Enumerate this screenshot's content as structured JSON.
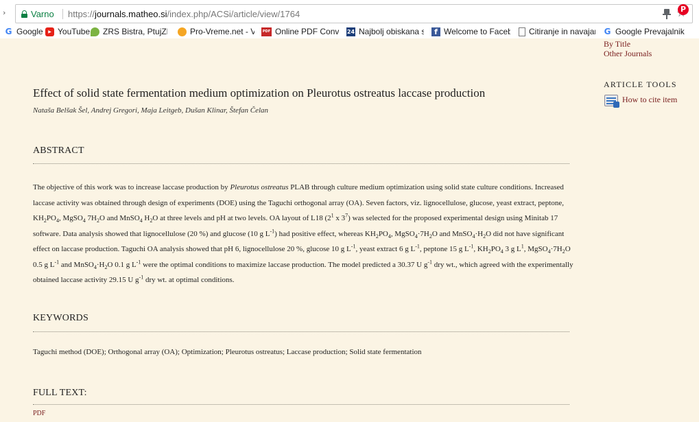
{
  "browser": {
    "secure_label": "Varno",
    "url_scheme": "https://",
    "url_host": "journals.matheo.si",
    "url_path": "/index.php/ACSi/article/view/1764"
  },
  "bookmarks": [
    {
      "label": "Google",
      "icon": "google-icon"
    },
    {
      "label": "YouTube",
      "icon": "youtube-icon"
    },
    {
      "label": "ZRS Bistra, PtujZRS Bi",
      "icon": "zrs-icon"
    },
    {
      "label": "Pro-Vreme.net - Vrem",
      "icon": "weather-icon"
    },
    {
      "label": "Online PDF Converter",
      "icon": "pdf-icon"
    },
    {
      "label": "Najbolj obiskana sple",
      "icon": "24ur-icon"
    },
    {
      "label": "Welcome to Faceboo",
      "icon": "facebook-icon"
    },
    {
      "label": "Citiranje in navajanje",
      "icon": "document-icon"
    },
    {
      "label": "Google Prevajalnik",
      "icon": "google-translate-icon"
    }
  ],
  "sidebar": {
    "by_title": "By Title",
    "other_journals": "Other Journals",
    "article_tools_heading": "ARTICLE TOOLS",
    "how_to_cite": "How to cite item"
  },
  "article": {
    "title": "Effect of solid state fermentation medium optimization on Pleurotus ostreatus laccase production",
    "authors": "Nataša Belšak Šel, Andrej Gregori, Maja Leitgeb, Dušan Klinar, Štefan Čelan",
    "abstract_heading": "ABSTRACT",
    "abstract": {
      "part1": "The objective of this work was to increase laccase production by ",
      "organism": "Pleurotus ostreatus",
      "part2": " PLAB through culture medium optimization using solid state culture conditions. Increased laccase activity was obtained through design of experiments (DOE) using the Taguchi orthogonal array (OA). Seven factors, viz. lignocellulose, glucose, yeast extract, peptone, KH",
      "s_2": "2",
      "t_po4": "PO",
      "s_4": "4",
      "t_mgso4": ", MgSO",
      "t_7h2o": " 7H",
      "t_o_and": "O and MnSO",
      "t_h2o": " H",
      "t_o_levels": "O at three levels and pH at two levels. OA layout of L18 (2",
      "p_1": "1",
      "t_x3": " x 3",
      "p_7": "7",
      "t_after_l18": ") was selected for the proposed experimental design using Minitab 17 software. Data analysis showed that lignocellulose (20 %) and glucose (10 g L",
      "p_m1": "-1",
      "t_pos_effect": ") had positive effect, whereas KH",
      "t_mgso4_dot": ", MgSO",
      "t_dot7h": "·7H",
      "t_o_and_mn": "O and MnSO",
      "t_dot_h": "·H",
      "t_did_not": "O did not have significant effect on laccase production. Taguchi OA analysis showed that pH 6, lignocellulose 20 %, glucose 10 g L",
      "t_yeast": ", yeast extract 6 g L",
      "t_comma": ",",
      "t_peptone": " peptone 15 g L",
      "t_kh2po4_3": ", KH",
      "t_3gl": " 3 g L",
      "p_1b": "1",
      "t_mg05": ", MgSO",
      "t_05gl": "O 0.5 g L",
      "t_and_mn01": " and MnSO",
      "t_01gl": "O 0.1 g L",
      "t_optimal": " were the optimal conditions to maximize laccase production. The model predicted a 30.37 U g",
      "t_dry1": " dry wt., which agreed with the experimentally obtained laccase activity 29.15 U g",
      "t_dry2": " dry wt. at optimal conditions."
    },
    "keywords_heading": "KEYWORDS",
    "keywords": "Taguchi method (DOE); Orthogonal array (OA); Optimization; Pleurotus ostreatus; Laccase production; Solid state fermentation",
    "full_text_heading": "FULL TEXT:",
    "pdf_link": "PDF"
  }
}
